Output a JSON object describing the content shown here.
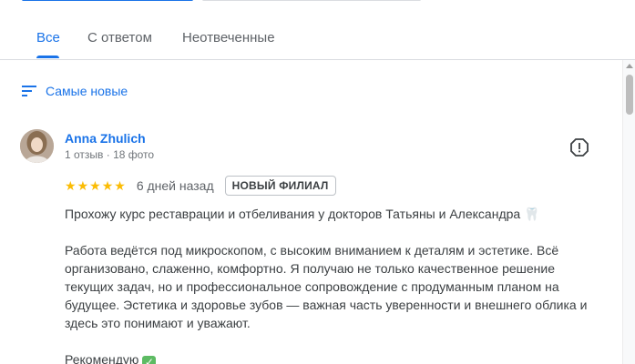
{
  "tabs": [
    {
      "label": "Все",
      "active": true
    },
    {
      "label": "С ответом",
      "active": false
    },
    {
      "label": "Неотвеченные",
      "active": false
    }
  ],
  "sort": {
    "label": "Самые новые"
  },
  "review": {
    "author": "Anna Zhulich",
    "meta": "1 отзыв · 18 фото",
    "rating": 5,
    "date": "6 дней назад",
    "badge": "НОВЫЙ ФИЛИАЛ",
    "paragraphs": [
      "Прохожу курс реставрации и отбеливания у докторов Татьяны и Александра",
      "Работа ведётся под микроскопом, с высоким вниманием к деталям и эстетике. Всё организовано, слаженно, комфортно. Я получаю не только качественное решение текущих задач, но и профессиональное сопровождение с продуманным планом на будущее. Эстетика и здоровье зубов — важная часть уверенности и внешнего облика и здесь это понимают и уважают.",
      "Рекомендую"
    ],
    "icons": {
      "tooth": "tooth-emoji",
      "check": "check-mark-emoji",
      "flag": "report-flag-icon"
    }
  },
  "colors": {
    "accent": "#1a73e8",
    "star": "#fbbc04",
    "check": "#5dbb63"
  }
}
